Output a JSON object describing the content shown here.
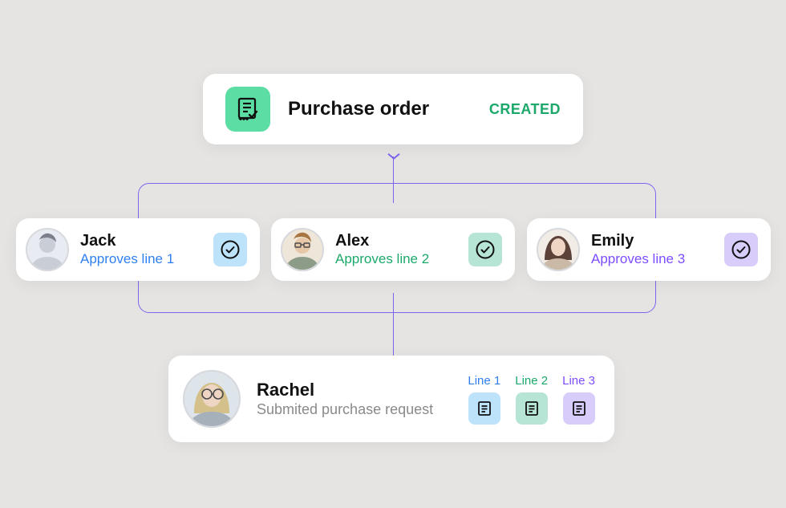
{
  "purchaseOrder": {
    "title": "Purchase order",
    "status": "CREATED"
  },
  "approvers": [
    {
      "name": "Jack",
      "action": "Approves line 1"
    },
    {
      "name": "Alex",
      "action": "Approves line 2"
    },
    {
      "name": "Emily",
      "action": "Approves line 3"
    }
  ],
  "requester": {
    "name": "Rachel",
    "action": "Submited purchase request",
    "lines": [
      "Line 1",
      "Line 2",
      "Line 3"
    ]
  },
  "colors": {
    "blue": "#2F80ED",
    "green": "#1CA86A",
    "purple": "#7C4DFF",
    "bgBlue": "#BDE3FB",
    "bgGreen": "#B6E4D5",
    "bgPurple": "#D7CCFA",
    "accentGreen": "#5BDDA4",
    "connector": "#7C66F0"
  }
}
